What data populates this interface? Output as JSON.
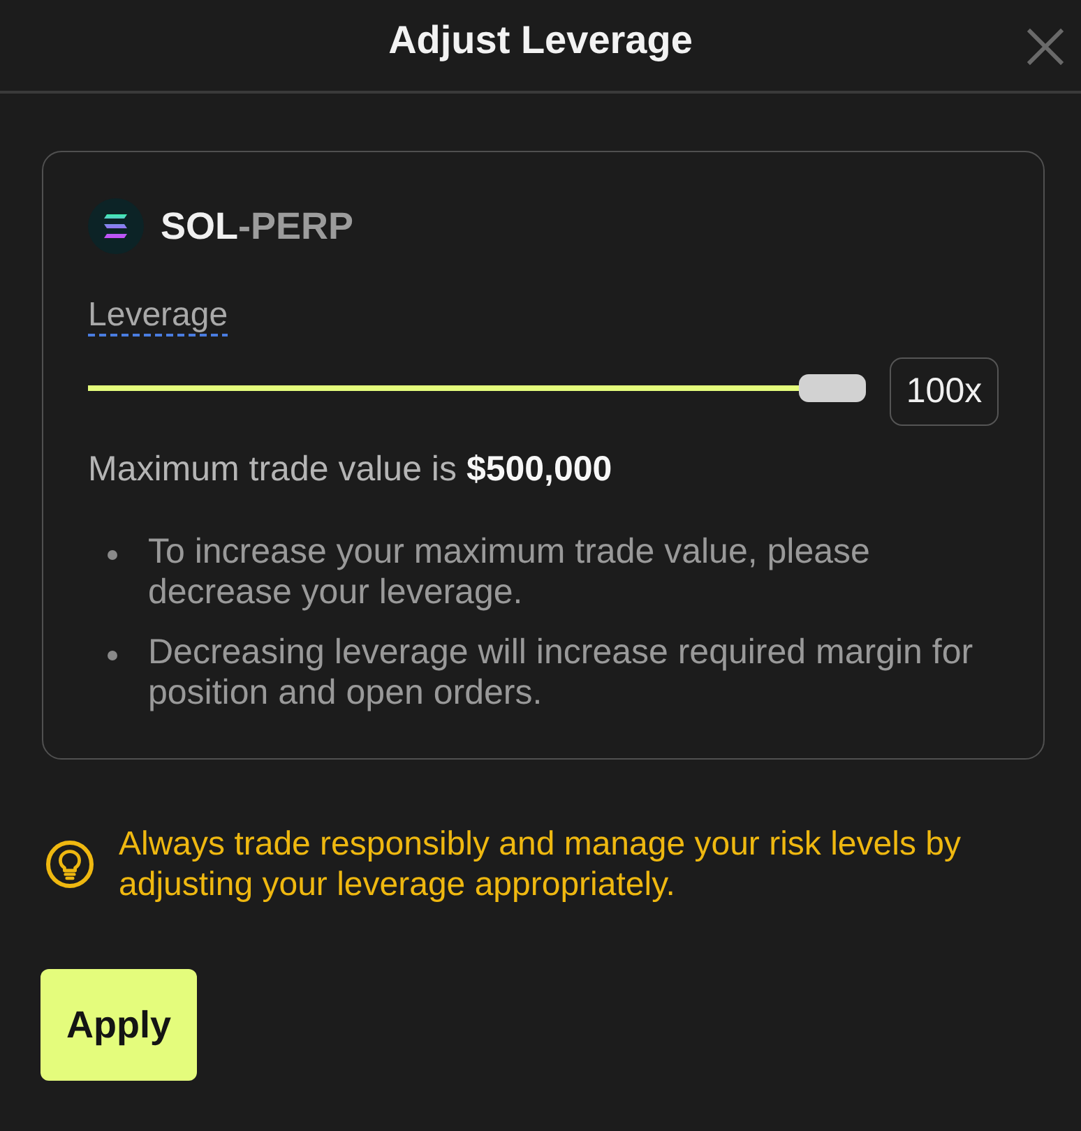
{
  "dialog": {
    "title": "Adjust Leverage"
  },
  "market": {
    "base": "SOL",
    "quote": "-PERP"
  },
  "leverage": {
    "label": "Leverage",
    "level": 1,
    "value": "100x"
  },
  "max_trade": "Maximum trade value is **$500,000**",
  "notes": [
    "To increase your maximum trade value, please decrease your leverage.",
    "Decreasing leverage will increase required margin for position and open orders."
  ],
  "warning": "Always trade responsibly and manage your risk levels by adjusting your leverage appropriately.",
  "buttons": [
    {
      "label": "Apply"
    }
  ]
}
